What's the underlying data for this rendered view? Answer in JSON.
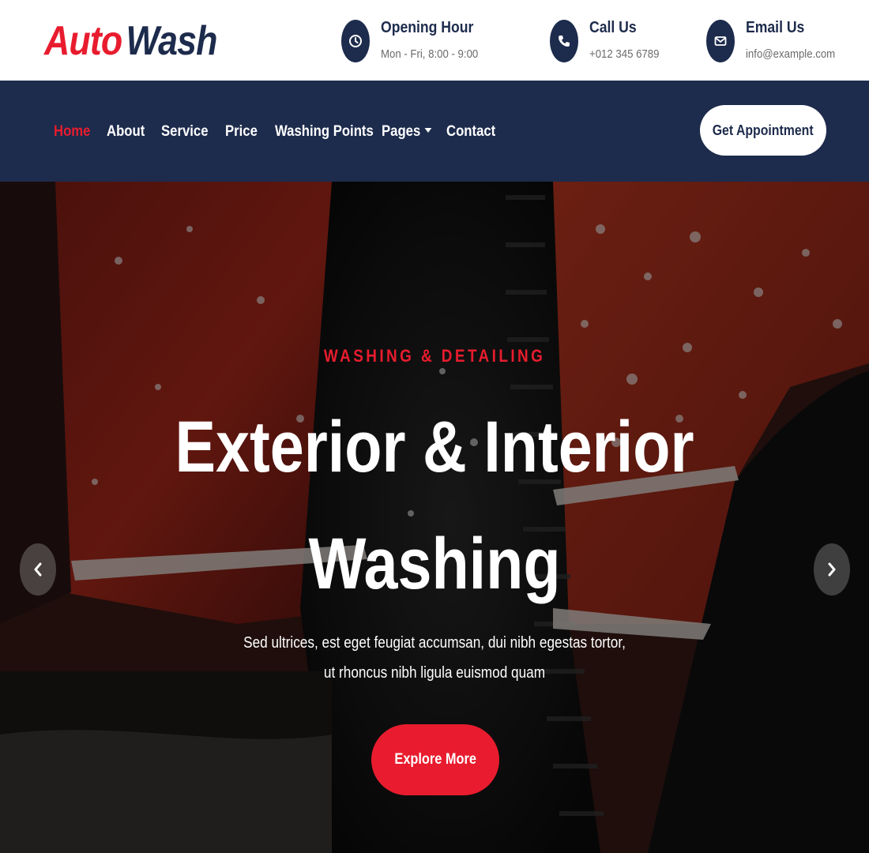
{
  "brand": {
    "part1": "Auto",
    "part2": "Wash",
    "color_primary": "#e81c2e",
    "color_dark": "#1d2b4c"
  },
  "contact": [
    {
      "icon": "clock-icon",
      "title": "Opening Hour",
      "value": "Mon - Fri, 8:00 - 9:00"
    },
    {
      "icon": "phone-icon",
      "title": "Call Us",
      "value": "+012 345 6789"
    },
    {
      "icon": "envelope-icon",
      "title": "Email Us",
      "value": "info@example.com"
    }
  ],
  "nav": {
    "items": [
      {
        "label": "Home",
        "active": true
      },
      {
        "label": "About"
      },
      {
        "label": "Service"
      },
      {
        "label": "Price"
      },
      {
        "label": "Washing Points"
      },
      {
        "label": "Pages",
        "dropdown": true
      },
      {
        "label": "Contact"
      }
    ],
    "cta": "Get Appointment"
  },
  "hero": {
    "kicker": "WASHING & DETAILING",
    "headline_line1": "Exterior & Interior",
    "headline_line2": "Washing",
    "description_line1": "Sed ultrices, est eget feugiat accumsan, dui nibh egestas tortor,",
    "description_line2": "ut rhoncus nibh ligula euismod quam",
    "button": "Explore More",
    "prev_icon": "chevron-left-icon",
    "next_icon": "chevron-right-icon"
  }
}
